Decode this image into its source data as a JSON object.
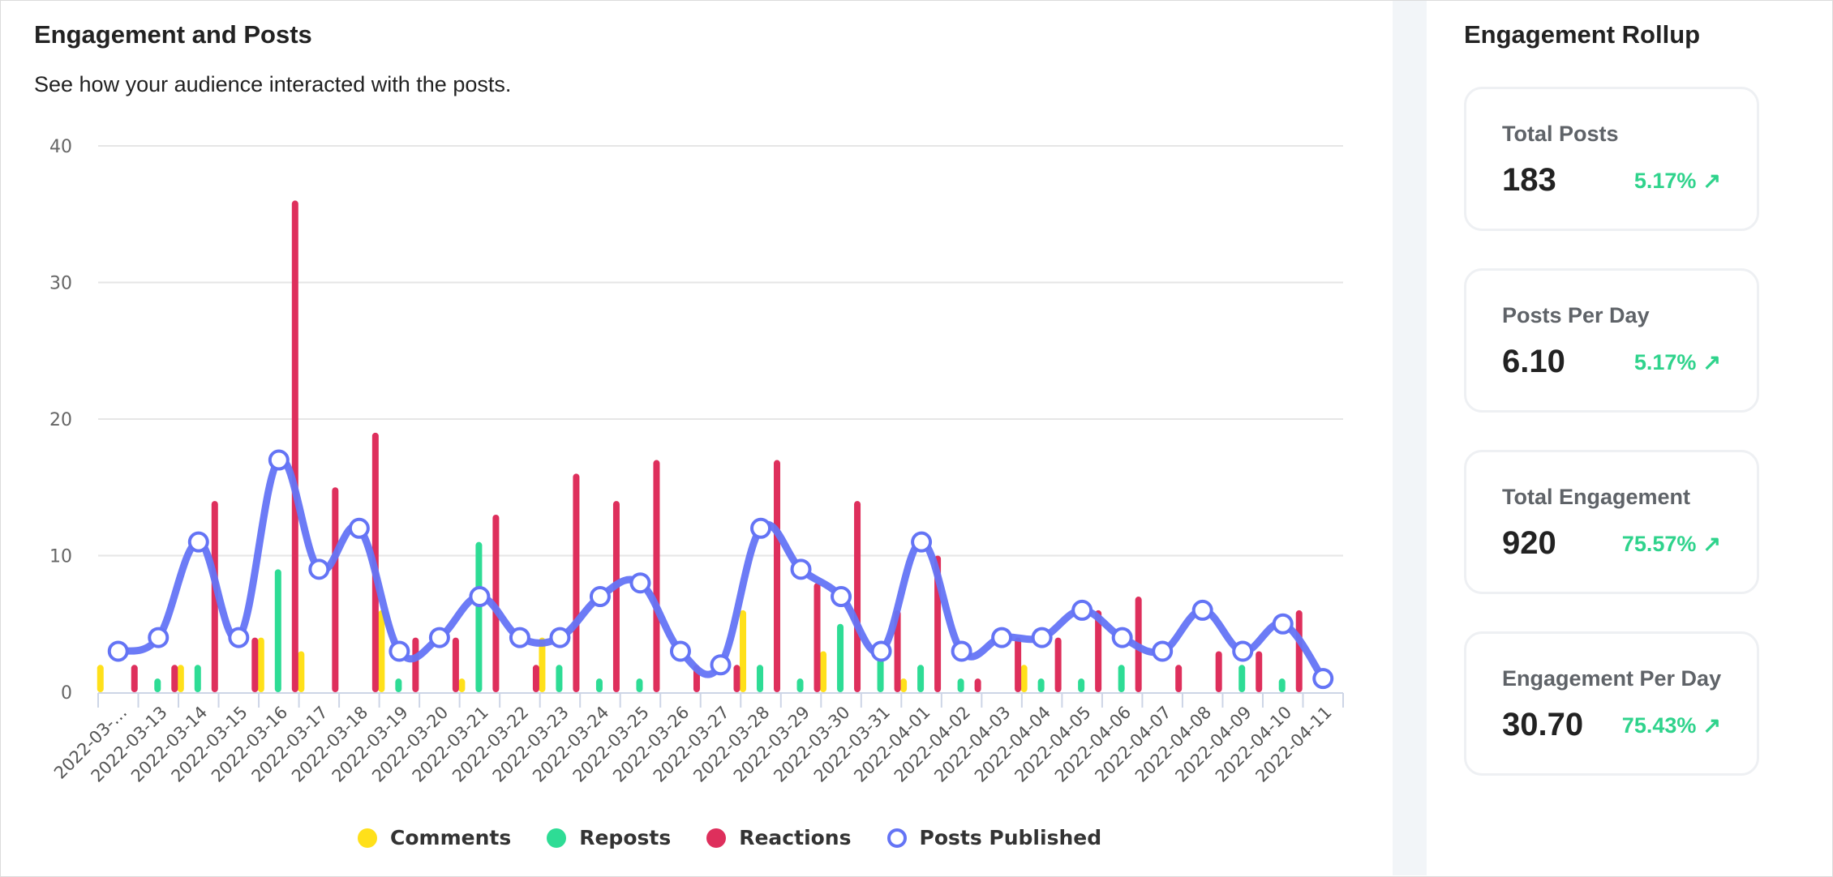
{
  "left_panel": {
    "title": "Engagement and Posts",
    "subtitle": "See how your audience interacted with the posts."
  },
  "legend": [
    {
      "label": "Comments",
      "color": "#ffe01a",
      "style": "filled"
    },
    {
      "label": "Reposts",
      "color": "#2edc95",
      "style": "filled"
    },
    {
      "label": "Reactions",
      "color": "#de2f5c",
      "style": "filled"
    },
    {
      "label": "Posts Published",
      "color": "#6474f5",
      "style": "hollow"
    }
  ],
  "rollup": {
    "title": "Engagement Rollup",
    "cards": [
      {
        "label": "Total Posts",
        "value": "183",
        "change": "5.17%",
        "trend_icon": "arrow-up-right"
      },
      {
        "label": "Posts Per Day",
        "value": "6.10",
        "change": "5.17%",
        "trend_icon": "arrow-up-right"
      },
      {
        "label": "Total Engagement",
        "value": "920",
        "change": "75.57%",
        "trend_icon": "arrow-up-right"
      },
      {
        "label": "Engagement Per Day",
        "value": "30.70",
        "change": "75.43%",
        "trend_icon": "arrow-up-right"
      }
    ],
    "change_color": "#2fd38c"
  },
  "chart_data": {
    "type": "bar",
    "title": "Engagement and Posts",
    "subtitle": "See how your audience interacted with the posts.",
    "xlabel": "",
    "ylabel": "",
    "ylim": [
      0,
      40
    ],
    "yticks": [
      0,
      10,
      20,
      30,
      40
    ],
    "grid": true,
    "legend_position": "bottom",
    "categories": [
      "2022-03-…",
      "2022-03-13",
      "2022-03-14",
      "2022-03-15",
      "2022-03-16",
      "2022-03-17",
      "2022-03-18",
      "2022-03-19",
      "2022-03-20",
      "2022-03-21",
      "2022-03-22",
      "2022-03-23",
      "2022-03-24",
      "2022-03-25",
      "2022-03-26",
      "2022-03-27",
      "2022-03-28",
      "2022-03-29",
      "2022-03-30",
      "2022-03-31",
      "2022-04-01",
      "2022-04-02",
      "2022-04-03",
      "2022-04-04",
      "2022-04-05",
      "2022-04-06",
      "2022-04-07",
      "2022-04-08",
      "2022-04-09",
      "2022-04-10",
      "2022-04-11"
    ],
    "series": [
      {
        "name": "Comments",
        "type": "bar",
        "color": "#ffe01a",
        "values": [
          2,
          0,
          2,
          0,
          4,
          3,
          0,
          6,
          0,
          1,
          0,
          4,
          0,
          0,
          0,
          0,
          6,
          0,
          3,
          0,
          1,
          0,
          0,
          2,
          0,
          0,
          0,
          0,
          0,
          0,
          0
        ]
      },
      {
        "name": "Reposts",
        "type": "bar",
        "color": "#2edc95",
        "values": [
          0,
          1,
          2,
          0,
          9,
          0,
          0,
          1,
          0,
          11,
          0,
          2,
          1,
          1,
          0,
          0,
          2,
          1,
          5,
          3,
          2,
          1,
          0,
          1,
          1,
          2,
          0,
          0,
          2,
          1,
          0
        ]
      },
      {
        "name": "Reactions",
        "type": "bar",
        "color": "#de2f5c",
        "values": [
          2,
          2,
          14,
          4,
          36,
          15,
          19,
          4,
          4,
          13,
          2,
          16,
          14,
          17,
          2,
          2,
          17,
          8,
          14,
          6,
          10,
          1,
          4,
          4,
          6,
          7,
          2,
          3,
          3,
          6,
          0
        ]
      },
      {
        "name": "Posts Published",
        "type": "line",
        "color": "#6474f5",
        "values": [
          3,
          4,
          11,
          4,
          17,
          9,
          12,
          3,
          4,
          7,
          4,
          4,
          7,
          8,
          3,
          2,
          12,
          9,
          7,
          3,
          11,
          3,
          4,
          4,
          6,
          4,
          3,
          6,
          3,
          5,
          1
        ]
      }
    ]
  }
}
